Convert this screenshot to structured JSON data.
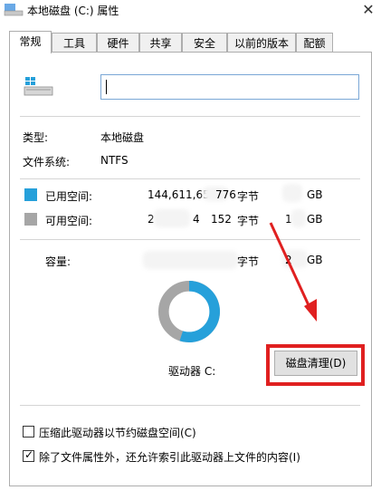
{
  "window": {
    "title": "本地磁盘 (C:) 属性",
    "close_glyph": "✕"
  },
  "tabs": [
    {
      "label": "常规",
      "active": true
    },
    {
      "label": "工具"
    },
    {
      "label": "硬件"
    },
    {
      "label": "共享"
    },
    {
      "label": "安全"
    },
    {
      "label": "以前的版本"
    },
    {
      "label": "配额"
    }
  ],
  "general": {
    "name_value": "",
    "type_label": "类型:",
    "type_value": "本地磁盘",
    "fs_label": "文件系统:",
    "fs_value": "NTFS",
    "used_label": "已用空间:",
    "used_bytes": "144,611,65",
    "used_bytes_tail": "776",
    "used_unit": "字节",
    "used_gb_unit": "GB",
    "free_label": "可用空间:",
    "free_bytes_head": "2",
    "free_bytes_mid": "4",
    "free_bytes_tail": "152",
    "free_unit": "字节",
    "free_gb_head": "1",
    "free_gb_unit": "GB",
    "capacity_label": "容量:",
    "capacity_unit": "字节",
    "capacity_gb_head": "2",
    "capacity_gb_unit": "GB",
    "drive_label": "驱动器 C:",
    "cleanup_button": "磁盘清理(D)",
    "compress_label": "压缩此驱动器以节约磁盘空间(C)",
    "compress_checked": false,
    "index_label": "除了文件属性外，还允许索引此驱动器上文件的内容(I)",
    "index_checked": true
  },
  "colors": {
    "used": "#26a0da",
    "free": "#a6a6a6",
    "highlight": "#e02020"
  },
  "usage": {
    "used_fraction": 0.55
  }
}
